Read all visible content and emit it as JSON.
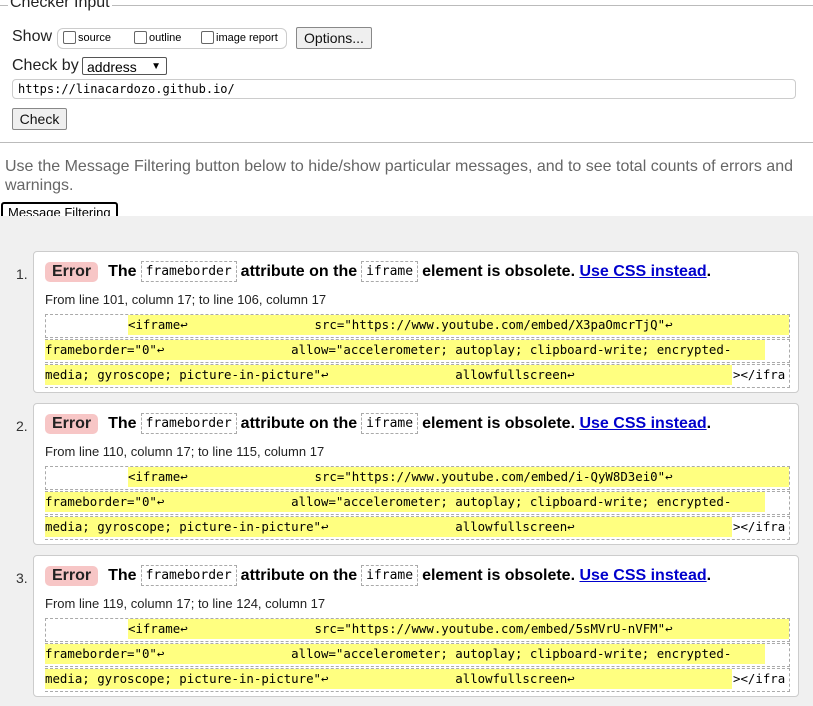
{
  "checker": {
    "legend": "Checker Input",
    "show_label": "Show",
    "options": [
      "source",
      "outline",
      "image report"
    ],
    "options_button": "Options...",
    "check_by_label": "Check by",
    "check_by_value": "address",
    "url": "https://linacardozo.github.io/",
    "check_button": "Check"
  },
  "info_text": "Use the Message Filtering button below to hide/show particular messages, and to see total counts of errors and warnings.",
  "message_filtering_button": "Message Filtering",
  "messages": [
    {
      "num": "1.",
      "type": "Error",
      "t1": "The",
      "c1": "frameborder",
      "t2": "attribute on the",
      "c2": "iframe",
      "t3": "element is obsolete.",
      "link": "Use CSS instead",
      "t4": ".",
      "location": "From line 101, column 17; to line 106, column 17",
      "l1": "<iframe↩                 src=\"https://www.youtube.com/embed/X3paOmcrTjQ\"↩",
      "l2": "frameborder=\"0\"↩                 allow=\"accelerometer; autoplay; clipboard-write; encrypted-",
      "l3": "media; gyroscope; picture-in-picture\"↩                 allowfullscreen↩              ",
      "l3end": "></ifra"
    },
    {
      "num": "2.",
      "type": "Error",
      "t1": "The",
      "c1": "frameborder",
      "t2": "attribute on the",
      "c2": "iframe",
      "t3": "element is obsolete.",
      "link": "Use CSS instead",
      "t4": ".",
      "location": "From line 110, column 17; to line 115, column 17",
      "l1": "<iframe↩                 src=\"https://www.youtube.com/embed/i-QyW8D3ei0\"↩",
      "l2": "frameborder=\"0\"↩                 allow=\"accelerometer; autoplay; clipboard-write; encrypted-",
      "l3": "media; gyroscope; picture-in-picture\"↩                 allowfullscreen↩              ",
      "l3end": "></ifra"
    },
    {
      "num": "3.",
      "type": "Error",
      "t1": "The",
      "c1": "frameborder",
      "t2": "attribute on the",
      "c2": "iframe",
      "t3": "element is obsolete.",
      "link": "Use CSS instead",
      "t4": ".",
      "location": "From line 119, column 17; to line 124, column 17",
      "l1": "<iframe↩                 src=\"https://www.youtube.com/embed/5sMVrU-nVFM\"↩",
      "l2": "frameborder=\"0\"↩                 allow=\"accelerometer; autoplay; clipboard-write; encrypted-",
      "l3": "media; gyroscope; picture-in-picture\"↩                 allowfullscreen↩              ",
      "l3end": "></ifra"
    }
  ]
}
